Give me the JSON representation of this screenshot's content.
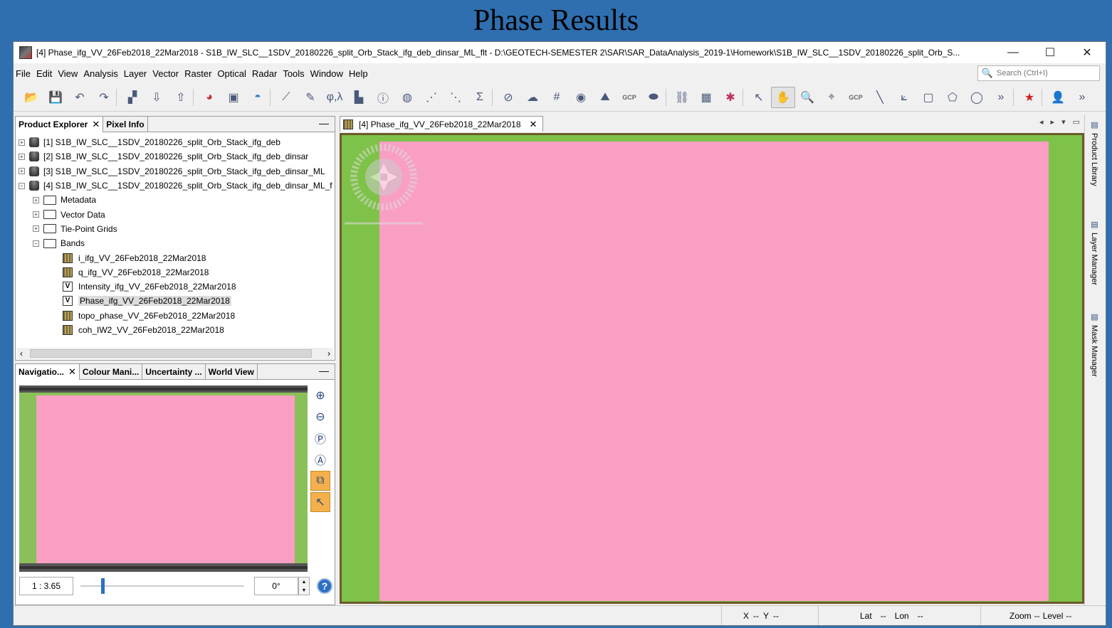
{
  "slide_title": "Phase Results",
  "window": {
    "title": "[4] Phase_ifg_VV_26Feb2018_22Mar2018 - S1B_IW_SLC__1SDV_20180226_split_Orb_Stack_ifg_deb_dinsar_ML_flt - D:\\GEOTECH-SEMESTER 2\\SAR\\SAR_DataAnalysis_2019-1\\Homework\\S1B_IW_SLC__1SDV_20180226_split_Orb_S...",
    "minimize": "—",
    "maximize": "☐",
    "close": "✕"
  },
  "menu": {
    "items": [
      "File",
      "Edit",
      "View",
      "Analysis",
      "Layer",
      "Vector",
      "Raster",
      "Optical",
      "Radar",
      "Tools",
      "Window",
      "Help"
    ],
    "search_placeholder": "Search (Ctrl+I)"
  },
  "toolbar": {
    "icons": [
      "open-product-icon",
      "save-product-icon",
      "undo-icon",
      "redo-icon",
      "band-maths-icon",
      "import-icon",
      "export-icon",
      "rgb-image-icon",
      "image-window-icon",
      "world-view-icon",
      "profile-plot-icon",
      "draw-icon",
      "phase-lambda-icon",
      "histogram-icon",
      "information-icon",
      "spectrum-icon",
      "scatter-plot-icon",
      "density-plot-icon",
      "statistics-icon",
      "layer-icon",
      "range-finder-icon",
      "graticule-icon",
      "pixel-pos-icon",
      "gcp-icon",
      "geometry-icon",
      "graph-builder-icon",
      "batch-processing-icon",
      "pin-manager-icon",
      "select-tool-icon",
      "pan-tool-icon",
      "zoom-tool-icon",
      "pin-placing-tool-icon",
      "gcp-placing-tool-icon",
      "line-drawing-tool-icon",
      "polyline-drawing-tool-icon",
      "rectangle-drawing-tool-icon",
      "polygon-drawing-tool-icon",
      "ellipse-drawing-tool-icon",
      "more-tools-icon",
      "star-icon",
      "user-icon",
      "overflow-icon"
    ],
    "gcp_label": "GCP",
    "sigma": "Σ",
    "phase_lambda": "φ,λ",
    "more": "»"
  },
  "product_explorer": {
    "tabs": [
      "Product Explorer",
      "Pixel Info"
    ],
    "products": [
      "[1] S1B_IW_SLC__1SDV_20180226_split_Orb_Stack_ifg_deb",
      "[2] S1B_IW_SLC__1SDV_20180226_split_Orb_Stack_ifg_deb_dinsar",
      "[3] S1B_IW_SLC__1SDV_20180226_split_Orb_Stack_ifg_deb_dinsar_ML",
      "[4] S1B_IW_SLC__1SDV_20180226_split_Orb_Stack_ifg_deb_dinsar_ML_f"
    ],
    "folders": [
      "Metadata",
      "Vector Data",
      "Tie-Point Grids",
      "Bands"
    ],
    "bands": [
      "i_ifg_VV_26Feb2018_22Mar2018",
      "q_ifg_VV_26Feb2018_22Mar2018",
      "Intensity_ifg_VV_26Feb2018_22Mar2018",
      "Phase_ifg_VV_26Feb2018_22Mar2018",
      "topo_phase_VV_26Feb2018_22Mar2018",
      "coh_IW2_VV_26Feb2018_22Mar2018"
    ],
    "virtual_band_marker": "V"
  },
  "navigation": {
    "tabs": [
      "Navigatio...",
      "Colour Mani...",
      "Uncertainty ...",
      "World View"
    ],
    "scale": "1 : 3.65",
    "rotation": "0°",
    "slider_fraction": 0.13,
    "help": "?"
  },
  "image_view": {
    "tab": "[4] Phase_ifg_VV_26Feb2018_22Mar2018"
  },
  "right_sidebar": {
    "tabs": [
      "Product Library",
      "Layer Manager",
      "Mask Manager"
    ]
  },
  "statusbar": {
    "x_label": "X",
    "x_val": "--",
    "y_label": "Y",
    "y_val": "--",
    "lat_label": "Lat",
    "lat_val": "--",
    "lon_label": "Lon",
    "lon_val": "--",
    "zoom_label": "Zoom",
    "zoom_val": "--",
    "level_label": "Level",
    "level_val": "--"
  },
  "colors": {
    "background": "#2f6fb0",
    "image_border": "#7fc24a",
    "accent": "#2d6fc4",
    "active_tool": "#f4b04a"
  }
}
